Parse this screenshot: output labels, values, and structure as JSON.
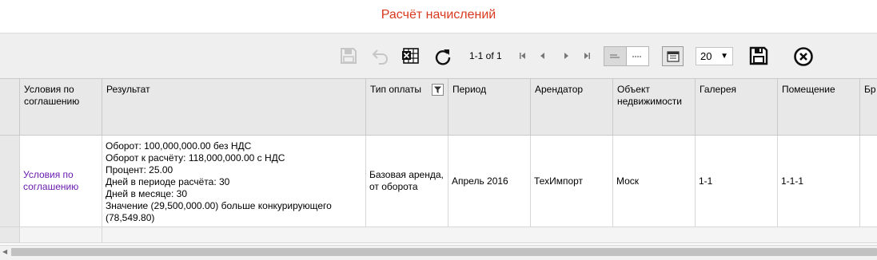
{
  "page_title": "Расчёт начислений",
  "toolbar": {
    "pager_text": "1-1 of 1",
    "page_size": "20",
    "icons": [
      "save-disk-icon",
      "undo-icon",
      "excel-export-icon",
      "refresh-icon",
      "first-page-icon",
      "prev-page-icon",
      "next-page-icon",
      "last-page-icon",
      "density-compact-icon",
      "density-normal-icon",
      "columns-icon",
      "save-settings-icon",
      "close-icon"
    ]
  },
  "table": {
    "headers": {
      "conditions": "Условия по соглашению",
      "result": "Результат",
      "payment_type": "Тип оплаты",
      "period": "Период",
      "tenant": "Арендатор",
      "property": "Объект недвижимости",
      "gallery": "Галерея",
      "premises": "Помещение",
      "truncated": "Бр"
    },
    "rows": [
      {
        "conditions": "Условия по соглашению",
        "result_lines": [
          "Оборот: 100,000,000.00 без НДС",
          "Оборот к расчёту: 118,000,000.00 с НДС",
          "Процент: 25.00",
          "Дней в периоде расчёта: 30",
          "Дней в месяце: 30",
          "Значение (29,500,000.00) больше конкурирующего",
          "(78,549.80)"
        ],
        "payment_type": "Базовая аренда, от оборота",
        "period": "Апрель 2016",
        "tenant": "ТехИмпорт",
        "property": "Моск",
        "gallery": "1-1",
        "premises": "1-1-1",
        "truncated": ""
      }
    ]
  },
  "colors": {
    "title": "#d9391e",
    "link": "#6a1bb0",
    "header_bg": "#e8e8e8"
  }
}
